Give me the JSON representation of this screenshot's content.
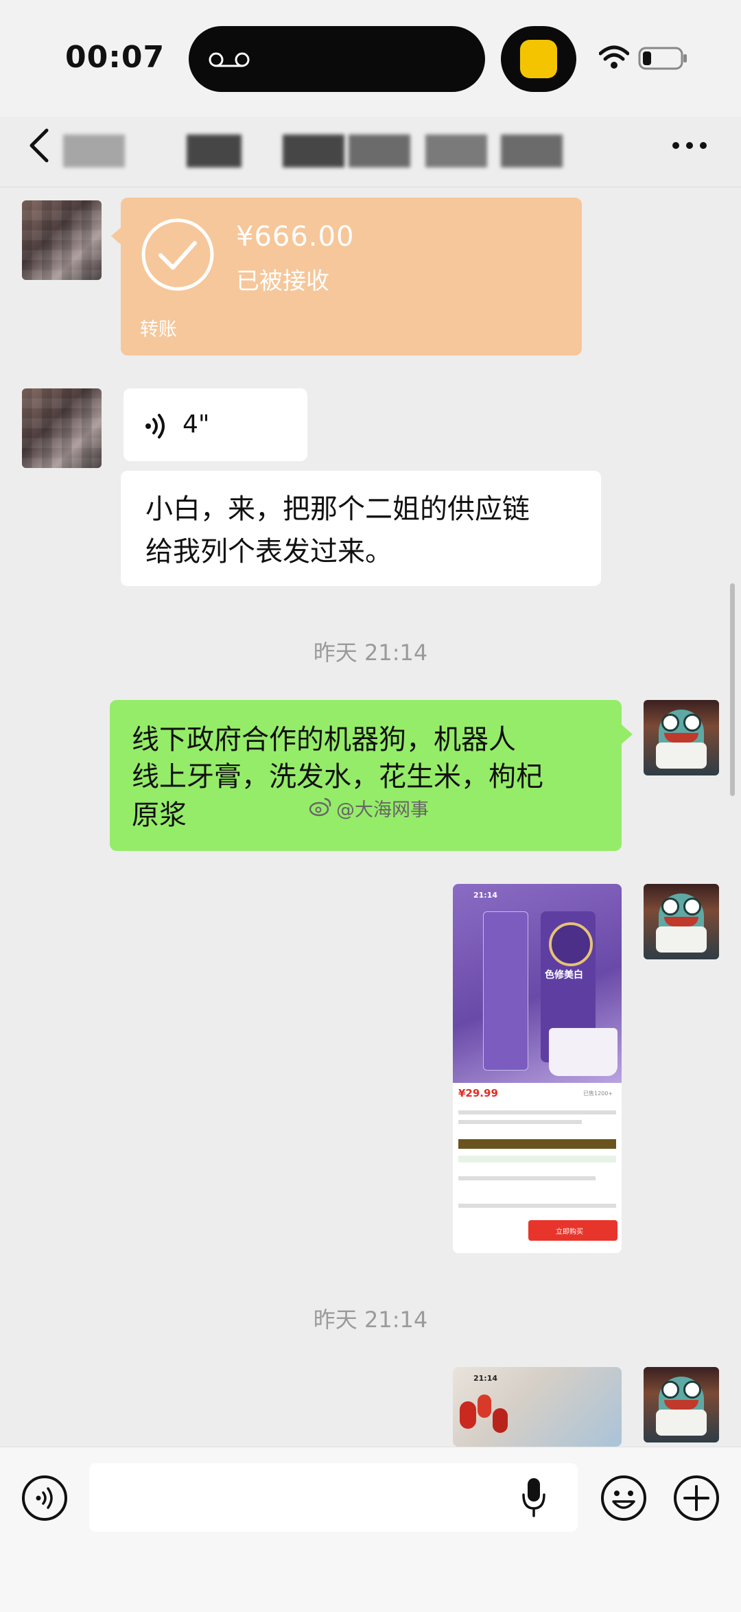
{
  "status_bar": {
    "time": "00:07"
  },
  "chat": {
    "transfer": {
      "amount": "¥666.00",
      "status": "已被接收",
      "label": "转账"
    },
    "voice_message": {
      "duration": "4\""
    },
    "incoming_text": {
      "line1": "小白，来，把那个二姐的供应链",
      "line2": "给我列个表发过来。"
    },
    "timestamps": [
      "昨天 21:14",
      "昨天 21:14"
    ],
    "outgoing_text": {
      "line1": "线下政府合作的机器狗，机器人",
      "line2": "线上牙膏，洗发水，花生米，枸杞",
      "line3": "原浆"
    },
    "watermark": "@大海网事",
    "product_screenshot": {
      "time": "21:14",
      "product_name": "色修美白",
      "price": "¥29.99",
      "sold": "已售1200+",
      "buy_button": "立即购买"
    },
    "second_screenshot": {
      "time": "21:14"
    }
  },
  "colors": {
    "transfer_card": "#f6c79a",
    "outgoing_bubble": "#95ec69",
    "chat_background": "#ededed"
  },
  "icons": [
    "back-icon",
    "more-icon",
    "voice-icon",
    "mic-icon",
    "emoji-icon",
    "plus-icon",
    "wifi-icon",
    "battery-icon"
  ]
}
